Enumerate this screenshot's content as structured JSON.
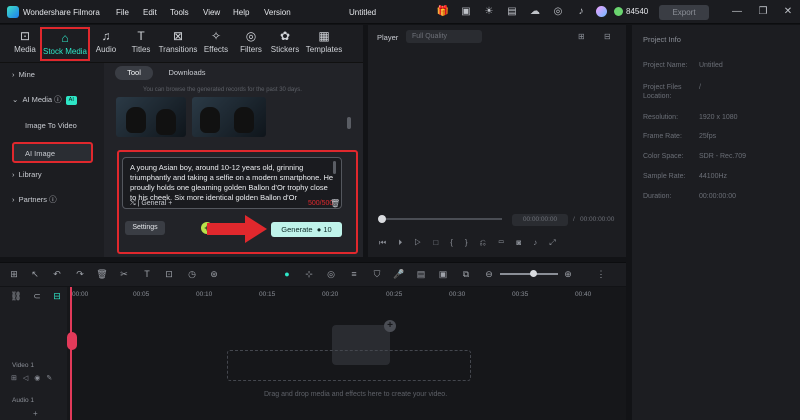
{
  "app": {
    "title": "Wondershare Filmora",
    "project": "Untitled",
    "credits": "84540",
    "export_label": "Export"
  },
  "menu": [
    "File",
    "Edit",
    "Tools",
    "View",
    "Help",
    "Version"
  ],
  "nav_tabs": [
    {
      "label": "Media",
      "icon": "media-icon"
    },
    {
      "label": "Stock Media",
      "icon": "stock-media-icon"
    },
    {
      "label": "Audio",
      "icon": "audio-icon"
    },
    {
      "label": "Titles",
      "icon": "titles-icon"
    },
    {
      "label": "Transitions",
      "icon": "transitions-icon"
    },
    {
      "label": "Effects",
      "icon": "effects-icon"
    },
    {
      "label": "Filters",
      "icon": "filters-icon"
    },
    {
      "label": "Stickers",
      "icon": "stickers-icon"
    },
    {
      "label": "Templates",
      "icon": "templates-icon"
    }
  ],
  "sidebar": {
    "mine": "Mine",
    "ai_media": "AI Media",
    "ai_badge": "AI",
    "image_to_video": "Image To Video",
    "ai_image": "AI Image",
    "library": "Library",
    "partners": "Partners"
  },
  "content": {
    "tab_tool": "Tool",
    "tab_downloads": "Downloads",
    "hint": "You can browse the generated records for the past 30 days.",
    "prompt": "A young Asian boy, around 10-12 years old, grinning triumphantly and taking a selfie on a modern smartphone. He proudly holds one gleaming golden Ballon d'Or trophy close to his cheek. Six more identical golden Ballon d'Or",
    "style": "General",
    "char_count": "500/500",
    "settings_label": "Settings",
    "generate_label": "Generate",
    "generate_cost": "10"
  },
  "player": {
    "label": "Player",
    "quality": "Full Quality",
    "time_current": "00:00:00:00",
    "time_total": "00:00:00:00"
  },
  "project_info": {
    "title": "Project Info",
    "rows": [
      {
        "label": "Project Name:",
        "value": "Untitled"
      },
      {
        "label": "Project Files Location:",
        "value": "/"
      },
      {
        "label": "Resolution:",
        "value": "1920 x 1080"
      },
      {
        "label": "Frame Rate:",
        "value": "25fps"
      },
      {
        "label": "Color Space:",
        "value": "SDR - Rec.709"
      },
      {
        "label": "Sample Rate:",
        "value": "44100Hz"
      },
      {
        "label": "Duration:",
        "value": "00:00:00:00"
      }
    ]
  },
  "timeline": {
    "ruler": [
      "00:00",
      "00:05",
      "00:10",
      "00:15",
      "00:20",
      "00:25",
      "00:30",
      "00:35",
      "00:40"
    ],
    "video_track": "Video 1",
    "audio_track": "Audio 1",
    "drop_hint": "Drag and drop media and effects here to create your video."
  },
  "colors": {
    "accent": "#2ee6c7",
    "highlight": "#e0282d",
    "playhead": "#e23a5a"
  }
}
